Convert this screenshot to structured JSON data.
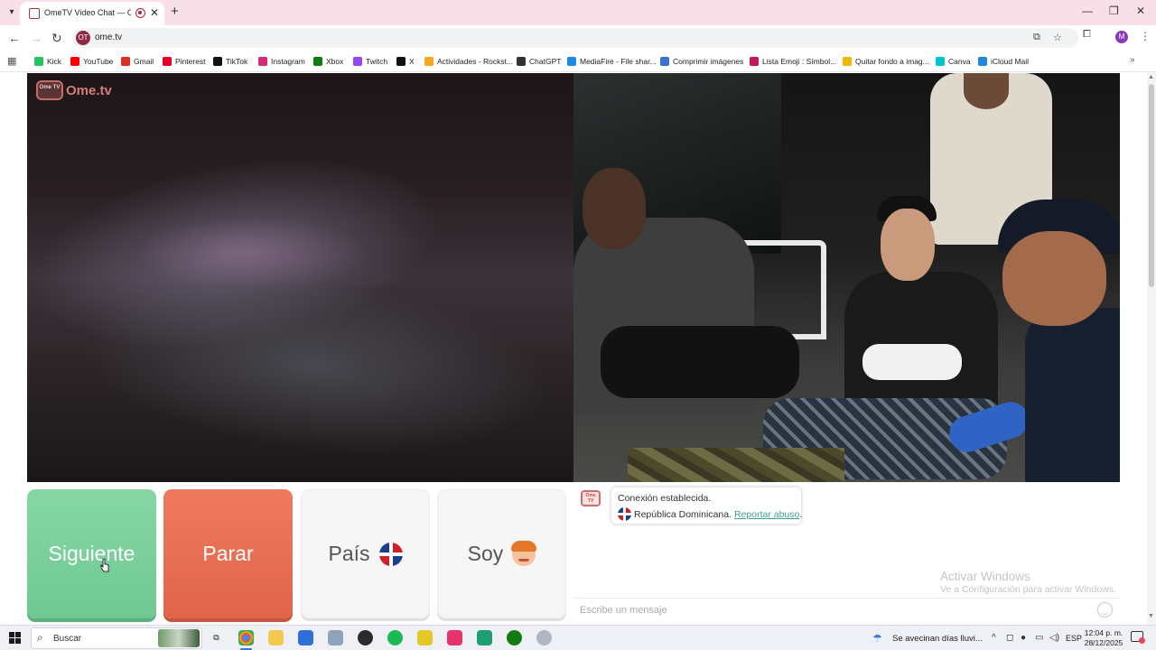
{
  "browser": {
    "tab_title": "OmeTV Video Chat — Ome",
    "url": "ome.tv",
    "omnibox_badge": "OT",
    "profile_initial": "M",
    "new_tab": "+",
    "close_tab": "✕"
  },
  "bookmarks": [
    {
      "label": "Kick",
      "icon": "kick-icon",
      "color": "#22c55e"
    },
    {
      "label": "YouTube",
      "icon": "youtube-icon",
      "color": "#ff0000"
    },
    {
      "label": "Gmail",
      "icon": "gmail-icon",
      "color": "#d93025"
    },
    {
      "label": "Pinterest",
      "icon": "pinterest-icon",
      "color": "#e60023"
    },
    {
      "label": "TikTok",
      "icon": "tiktok-icon",
      "color": "#111111"
    },
    {
      "label": "Instagram",
      "icon": "instagram-icon",
      "color": "#d62976"
    },
    {
      "label": "Xbox",
      "icon": "xbox-icon",
      "color": "#107c10"
    },
    {
      "label": "Twitch",
      "icon": "twitch-icon",
      "color": "#9146ff"
    },
    {
      "label": "X",
      "icon": "x-icon",
      "color": "#111111"
    },
    {
      "label": "Actividades - Rockst...",
      "icon": "rockstar-icon",
      "color": "#f5a623"
    },
    {
      "label": "ChatGPT",
      "icon": "chatgpt-icon",
      "color": "#333333"
    },
    {
      "label": "MediaFire - File shar...",
      "icon": "mediafire-icon",
      "color": "#1e88e5"
    },
    {
      "label": "Comprimir imágenes",
      "icon": "compress-icon",
      "color": "#3b6fd9"
    },
    {
      "label": "Lista Emoji : Símbol...",
      "icon": "emoji-list-icon",
      "color": "#c2185b"
    },
    {
      "label": "Quitar fondo a imag...",
      "icon": "removebg-icon",
      "color": "#f2b705"
    },
    {
      "label": "Canva",
      "icon": "canva-icon",
      "color": "#00c4cc"
    },
    {
      "label": "iCloud Mail",
      "icon": "icloud-mail-icon",
      "color": "#1e88e5"
    }
  ],
  "logo": {
    "tv_text": "Ome TV",
    "text": "Ome.tv"
  },
  "controls": {
    "next_label": "Siguiente",
    "stop_label": "Parar",
    "country_label": "País",
    "soy_label": "Soy"
  },
  "chat": {
    "avatar_text": "Ome TV",
    "connection_text": "Conexión establecida.",
    "country_text": "República Dominicana.",
    "report_link": "Reportar abuso",
    "report_suffix": ".",
    "placeholder": "Escribe un mensaje"
  },
  "watermark": {
    "title": "Activar Windows",
    "subtitle": "Ve a Configuración para activar Windows."
  },
  "taskbar": {
    "search_label": "Buscar",
    "weather_text": "Se avecinan días lluvi...",
    "language": "ESP",
    "time": "12:04 p. m.",
    "date": "28/12/2025"
  },
  "colors": {
    "next_green": "#79cf9a",
    "stop_red": "#e86d51",
    "tab_bar_pink": "#f9dfe8",
    "report_link": "#3f9e93"
  }
}
